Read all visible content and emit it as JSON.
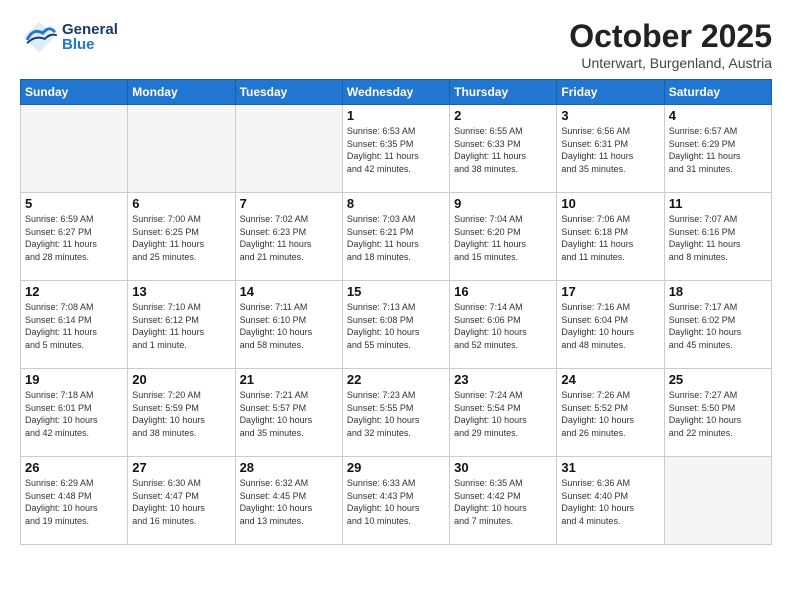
{
  "header": {
    "logo": {
      "general": "General",
      "blue": "Blue"
    },
    "month": "October 2025",
    "location": "Unterwart, Burgenland, Austria"
  },
  "weekdays": [
    "Sunday",
    "Monday",
    "Tuesday",
    "Wednesday",
    "Thursday",
    "Friday",
    "Saturday"
  ],
  "weeks": [
    [
      {
        "day": "",
        "info": ""
      },
      {
        "day": "",
        "info": ""
      },
      {
        "day": "",
        "info": ""
      },
      {
        "day": "1",
        "info": "Sunrise: 6:53 AM\nSunset: 6:35 PM\nDaylight: 11 hours\nand 42 minutes."
      },
      {
        "day": "2",
        "info": "Sunrise: 6:55 AM\nSunset: 6:33 PM\nDaylight: 11 hours\nand 38 minutes."
      },
      {
        "day": "3",
        "info": "Sunrise: 6:56 AM\nSunset: 6:31 PM\nDaylight: 11 hours\nand 35 minutes."
      },
      {
        "day": "4",
        "info": "Sunrise: 6:57 AM\nSunset: 6:29 PM\nDaylight: 11 hours\nand 31 minutes."
      }
    ],
    [
      {
        "day": "5",
        "info": "Sunrise: 6:59 AM\nSunset: 6:27 PM\nDaylight: 11 hours\nand 28 minutes."
      },
      {
        "day": "6",
        "info": "Sunrise: 7:00 AM\nSunset: 6:25 PM\nDaylight: 11 hours\nand 25 minutes."
      },
      {
        "day": "7",
        "info": "Sunrise: 7:02 AM\nSunset: 6:23 PM\nDaylight: 11 hours\nand 21 minutes."
      },
      {
        "day": "8",
        "info": "Sunrise: 7:03 AM\nSunset: 6:21 PM\nDaylight: 11 hours\nand 18 minutes."
      },
      {
        "day": "9",
        "info": "Sunrise: 7:04 AM\nSunset: 6:20 PM\nDaylight: 11 hours\nand 15 minutes."
      },
      {
        "day": "10",
        "info": "Sunrise: 7:06 AM\nSunset: 6:18 PM\nDaylight: 11 hours\nand 11 minutes."
      },
      {
        "day": "11",
        "info": "Sunrise: 7:07 AM\nSunset: 6:16 PM\nDaylight: 11 hours\nand 8 minutes."
      }
    ],
    [
      {
        "day": "12",
        "info": "Sunrise: 7:08 AM\nSunset: 6:14 PM\nDaylight: 11 hours\nand 5 minutes."
      },
      {
        "day": "13",
        "info": "Sunrise: 7:10 AM\nSunset: 6:12 PM\nDaylight: 11 hours\nand 1 minute."
      },
      {
        "day": "14",
        "info": "Sunrise: 7:11 AM\nSunset: 6:10 PM\nDaylight: 10 hours\nand 58 minutes."
      },
      {
        "day": "15",
        "info": "Sunrise: 7:13 AM\nSunset: 6:08 PM\nDaylight: 10 hours\nand 55 minutes."
      },
      {
        "day": "16",
        "info": "Sunrise: 7:14 AM\nSunset: 6:06 PM\nDaylight: 10 hours\nand 52 minutes."
      },
      {
        "day": "17",
        "info": "Sunrise: 7:16 AM\nSunset: 6:04 PM\nDaylight: 10 hours\nand 48 minutes."
      },
      {
        "day": "18",
        "info": "Sunrise: 7:17 AM\nSunset: 6:02 PM\nDaylight: 10 hours\nand 45 minutes."
      }
    ],
    [
      {
        "day": "19",
        "info": "Sunrise: 7:18 AM\nSunset: 6:01 PM\nDaylight: 10 hours\nand 42 minutes."
      },
      {
        "day": "20",
        "info": "Sunrise: 7:20 AM\nSunset: 5:59 PM\nDaylight: 10 hours\nand 38 minutes."
      },
      {
        "day": "21",
        "info": "Sunrise: 7:21 AM\nSunset: 5:57 PM\nDaylight: 10 hours\nand 35 minutes."
      },
      {
        "day": "22",
        "info": "Sunrise: 7:23 AM\nSunset: 5:55 PM\nDaylight: 10 hours\nand 32 minutes."
      },
      {
        "day": "23",
        "info": "Sunrise: 7:24 AM\nSunset: 5:54 PM\nDaylight: 10 hours\nand 29 minutes."
      },
      {
        "day": "24",
        "info": "Sunrise: 7:26 AM\nSunset: 5:52 PM\nDaylight: 10 hours\nand 26 minutes."
      },
      {
        "day": "25",
        "info": "Sunrise: 7:27 AM\nSunset: 5:50 PM\nDaylight: 10 hours\nand 22 minutes."
      }
    ],
    [
      {
        "day": "26",
        "info": "Sunrise: 6:29 AM\nSunset: 4:48 PM\nDaylight: 10 hours\nand 19 minutes."
      },
      {
        "day": "27",
        "info": "Sunrise: 6:30 AM\nSunset: 4:47 PM\nDaylight: 10 hours\nand 16 minutes."
      },
      {
        "day": "28",
        "info": "Sunrise: 6:32 AM\nSunset: 4:45 PM\nDaylight: 10 hours\nand 13 minutes."
      },
      {
        "day": "29",
        "info": "Sunrise: 6:33 AM\nSunset: 4:43 PM\nDaylight: 10 hours\nand 10 minutes."
      },
      {
        "day": "30",
        "info": "Sunrise: 6:35 AM\nSunset: 4:42 PM\nDaylight: 10 hours\nand 7 minutes."
      },
      {
        "day": "31",
        "info": "Sunrise: 6:36 AM\nSunset: 4:40 PM\nDaylight: 10 hours\nand 4 minutes."
      },
      {
        "day": "",
        "info": ""
      }
    ]
  ]
}
